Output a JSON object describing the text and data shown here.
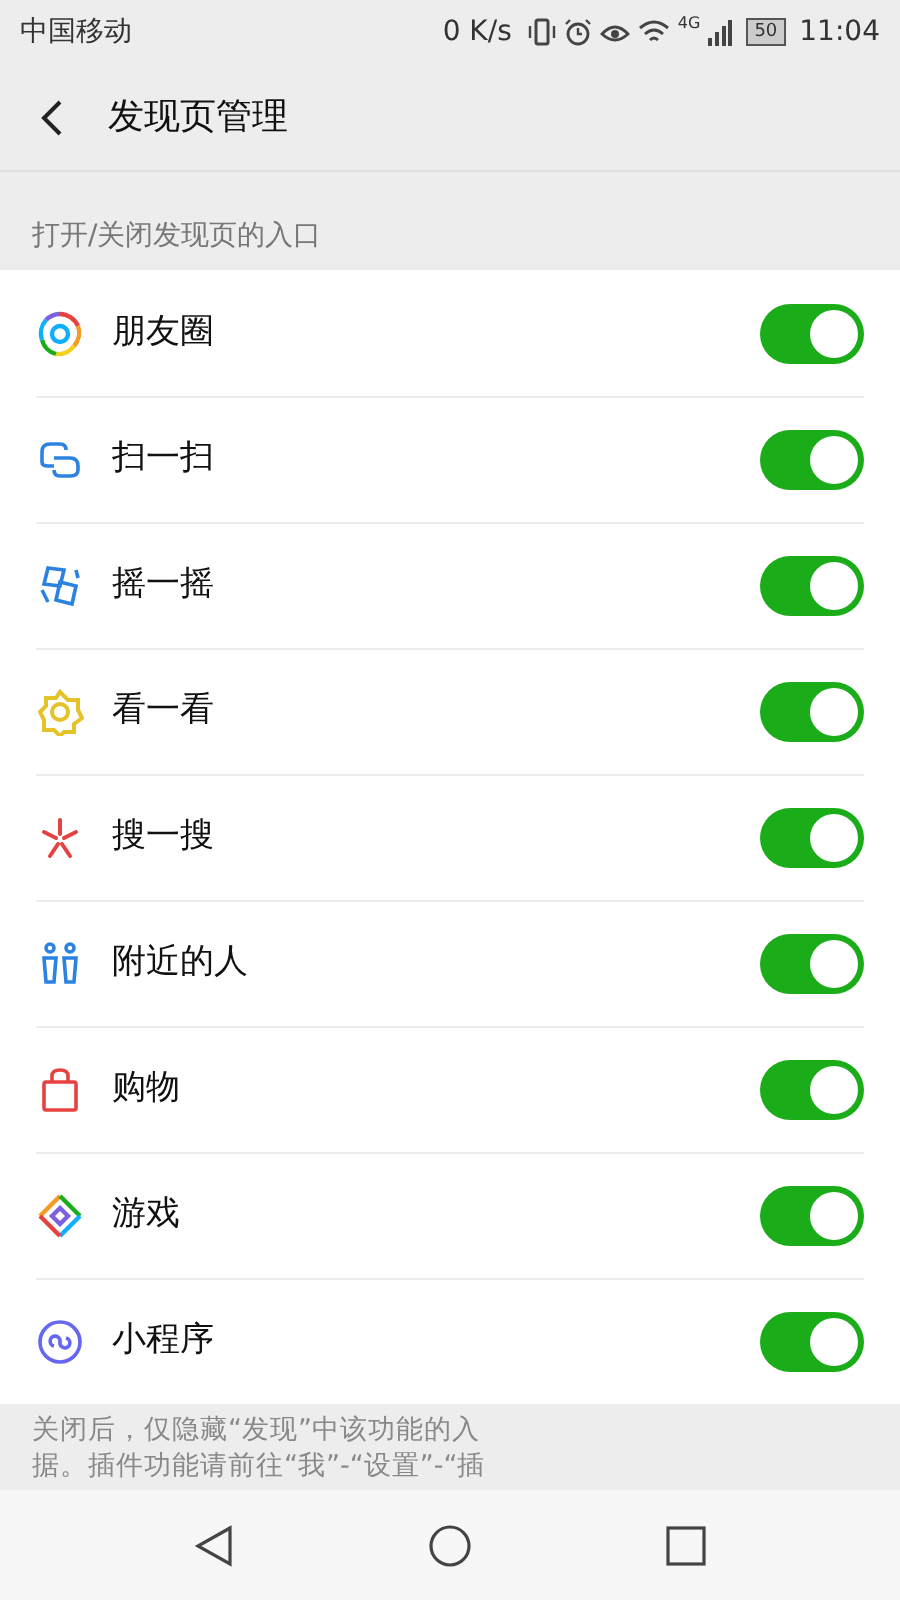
{
  "status_bar": {
    "carrier": "中国移动",
    "speed": "0 K/s",
    "network": "4G",
    "battery": "50",
    "time": "11:04"
  },
  "header": {
    "title": "发现页管理"
  },
  "section_label": "打开/关闭发现页的入口",
  "entries": [
    {
      "label": "朋友圈",
      "on": true
    },
    {
      "label": "扫一扫",
      "on": true
    },
    {
      "label": "摇一摇",
      "on": true
    },
    {
      "label": "看一看",
      "on": true
    },
    {
      "label": "搜一搜",
      "on": true
    },
    {
      "label": "附近的人",
      "on": true
    },
    {
      "label": "购物",
      "on": true
    },
    {
      "label": "游戏",
      "on": true
    },
    {
      "label": "小程序",
      "on": true
    }
  ],
  "footer_lines": [
    "关闭后，仅隐藏“发现”中该功能的入",
    "据。插件功能请前往“我”-“设置”-“插"
  ]
}
